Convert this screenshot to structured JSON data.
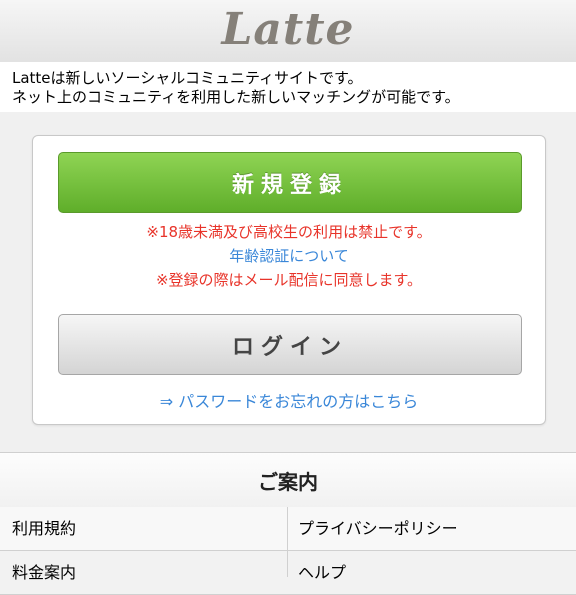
{
  "header": {
    "logo_text": "Latte"
  },
  "intro": {
    "line1": "Latteは新しいソーシャルコミュニティサイトです。",
    "line2": "ネット上のコミュニティを利用した新しいマッチングが可能です。"
  },
  "card": {
    "register_label": "新規登録",
    "notice_age": "※18歳未満及び高校生の利用は禁止です。",
    "age_verification_link": "年齢認証について",
    "notice_mail": "※登録の際はメール配信に同意します。",
    "login_label": "ログイン",
    "password_link": "⇒ パスワードをお忘れの方はこちら"
  },
  "info": {
    "title": "ご案内",
    "rows": [
      {
        "left": "利用規約",
        "right": "プライバシーポリシー"
      },
      {
        "left": "料金案内",
        "right": "ヘルプ"
      }
    ]
  },
  "colors": {
    "register_green": "#6cbb35",
    "notice_red": "#e8342a",
    "link_blue": "#3a87d8"
  }
}
